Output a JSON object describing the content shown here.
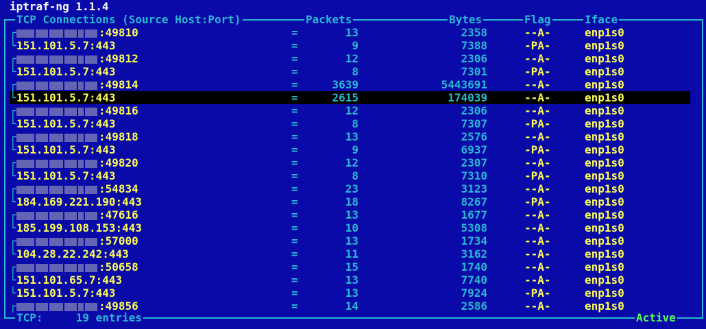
{
  "app": {
    "title": "iptraf-ng 1.1.4"
  },
  "header": {
    "connections": "TCP Connections (Source Host:Port)",
    "packets": "Packets",
    "bytes": "Bytes",
    "flag": "Flag",
    "iface": "Iface"
  },
  "rows": [
    {
      "host": "",
      "port": ":49810",
      "eq": "=",
      "packets": "13",
      "bytes": "2358",
      "flag": "--A-",
      "iface": "enp1s0",
      "masked": true
    },
    {
      "host": "151.101.5.7",
      "port": ":443",
      "eq": "=",
      "packets": "9",
      "bytes": "7388",
      "flag": "-PA-",
      "iface": "enp1s0",
      "masked": false
    },
    {
      "host": "",
      "port": ":49812",
      "eq": "=",
      "packets": "12",
      "bytes": "2306",
      "flag": "--A-",
      "iface": "enp1s0",
      "masked": true
    },
    {
      "host": "151.101.5.7",
      "port": ":443",
      "eq": "=",
      "packets": "8",
      "bytes": "7301",
      "flag": "-PA-",
      "iface": "enp1s0",
      "masked": false
    },
    {
      "host": "",
      "port": ":49814",
      "eq": "=",
      "packets": "3639",
      "bytes": "5443691",
      "flag": "--A-",
      "iface": "enp1s0",
      "masked": true
    },
    {
      "host": "151.101.5.7",
      "port": ":443",
      "eq": "=",
      "packets": "2615",
      "bytes": "174039",
      "flag": "--A-",
      "iface": "enp1s0",
      "masked": false,
      "selected": true
    },
    {
      "host": "",
      "port": ":49816",
      "eq": "=",
      "packets": "12",
      "bytes": "2306",
      "flag": "--A-",
      "iface": "enp1s0",
      "masked": true
    },
    {
      "host": "151.101.5.7",
      "port": ":443",
      "eq": "=",
      "packets": "8",
      "bytes": "7307",
      "flag": "-PA-",
      "iface": "enp1s0",
      "masked": false
    },
    {
      "host": "",
      "port": ":49818",
      "eq": "=",
      "packets": "13",
      "bytes": "2576",
      "flag": "--A-",
      "iface": "enp1s0",
      "masked": true
    },
    {
      "host": "151.101.5.7",
      "port": ":443",
      "eq": "=",
      "packets": "9",
      "bytes": "6937",
      "flag": "-PA-",
      "iface": "enp1s0",
      "masked": false
    },
    {
      "host": "",
      "port": ":49820",
      "eq": "=",
      "packets": "12",
      "bytes": "2307",
      "flag": "--A-",
      "iface": "enp1s0",
      "masked": true
    },
    {
      "host": "151.101.5.7",
      "port": ":443",
      "eq": "=",
      "packets": "8",
      "bytes": "7310",
      "flag": "-PA-",
      "iface": "enp1s0",
      "masked": false
    },
    {
      "host": "",
      "port": ":54834",
      "eq": "=",
      "packets": "23",
      "bytes": "3123",
      "flag": "--A-",
      "iface": "enp1s0",
      "masked": true
    },
    {
      "host": "184.169.221.190",
      "port": ":443",
      "eq": "=",
      "packets": "18",
      "bytes": "8267",
      "flag": "-PA-",
      "iface": "enp1s0",
      "masked": false
    },
    {
      "host": "",
      "port": ":47616",
      "eq": "=",
      "packets": "13",
      "bytes": "1677",
      "flag": "--A-",
      "iface": "enp1s0",
      "masked": true
    },
    {
      "host": "185.199.108.153",
      "port": ":443",
      "eq": "=",
      "packets": "10",
      "bytes": "5308",
      "flag": "--A-",
      "iface": "enp1s0",
      "masked": false
    },
    {
      "host": "",
      "port": ":57000",
      "eq": "=",
      "packets": "13",
      "bytes": "1734",
      "flag": "--A-",
      "iface": "enp1s0",
      "masked": true
    },
    {
      "host": "104.28.22.242",
      "port": ":443",
      "eq": "=",
      "packets": "11",
      "bytes": "3162",
      "flag": "--A-",
      "iface": "enp1s0",
      "masked": false
    },
    {
      "host": "",
      "port": ":50658",
      "eq": "=",
      "packets": "15",
      "bytes": "1740",
      "flag": "--A-",
      "iface": "enp1s0",
      "masked": true
    },
    {
      "host": "151.101.65.7",
      "port": ":443",
      "eq": "=",
      "packets": "13",
      "bytes": "7740",
      "flag": "--A-",
      "iface": "enp1s0",
      "masked": false
    },
    {
      "host": "151.101.5.7",
      "port": ":443",
      "eq": "=",
      "packets": "13",
      "bytes": "7924",
      "flag": "-PA-",
      "iface": "enp1s0",
      "masked": false
    },
    {
      "host": "",
      "port": ":49856",
      "eq": "=",
      "packets": "14",
      "bytes": "2586",
      "flag": "--A-",
      "iface": "enp1s0",
      "masked": true
    }
  ],
  "status": {
    "protocol": "TCP:",
    "entries": "19 entries",
    "state": "Active"
  },
  "colors": {
    "background": "#0a0aa8",
    "frame": "#2ab8d0",
    "host_text": "#ffff55",
    "selected_bg": "#000000",
    "active": "#55ff55"
  }
}
